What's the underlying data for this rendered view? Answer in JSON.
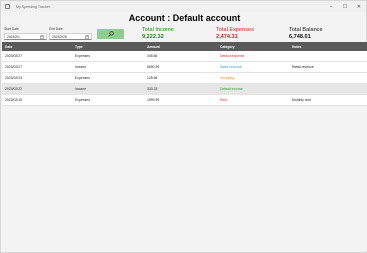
{
  "window": {
    "title": "My Spending Tracker",
    "controls": [
      "–",
      "☐",
      "✕"
    ]
  },
  "page": {
    "title": "Account : Default account"
  },
  "filters": {
    "start_label": "Start Date",
    "start_value": "2023/2/1",
    "end_label": "End Date",
    "end_value": "2023/2/28",
    "search_icon": "search-icon"
  },
  "summary": {
    "income_label": "Total Income",
    "income_value": "9,222.32",
    "income_color": "#1a8a1a",
    "expenses_label": "Total Expenses",
    "expenses_value": "2,474.31",
    "expenses_color": "#d42020",
    "balance_label": "Total Balance",
    "balance_value": "6,748.01",
    "balance_color": "#111111"
  },
  "table": {
    "columns": [
      "Date",
      "Type",
      "Amount",
      "Category",
      "Notes"
    ],
    "rows": [
      {
        "date": "2023/02/27",
        "type": "Expenses",
        "amount": "345.66",
        "category": "Default expense",
        "category_color": "#e03030",
        "notes": ""
      },
      {
        "date": "2023/02/27",
        "type": "Income",
        "amount": "6690.99",
        "category": "Sales revenue",
        "category_color": "#2a9adf",
        "notes": "Retail revenue"
      },
      {
        "date": "2023/02/23",
        "type": "Expenses",
        "amount": "128.66",
        "category": "Shopping",
        "category_color": "#f08a20",
        "notes": ""
      },
      {
        "date": "2023/02/22",
        "type": "Income",
        "amount": "333.33",
        "category": "Default income",
        "category_color": "#2a9a2a",
        "notes": ""
      },
      {
        "date": "2023/02/15",
        "type": "Expenses",
        "amount": "1999.99",
        "category": "Rent",
        "category_color": "#e03030",
        "notes": "Monthly rent"
      }
    ],
    "selected_row": 3
  }
}
